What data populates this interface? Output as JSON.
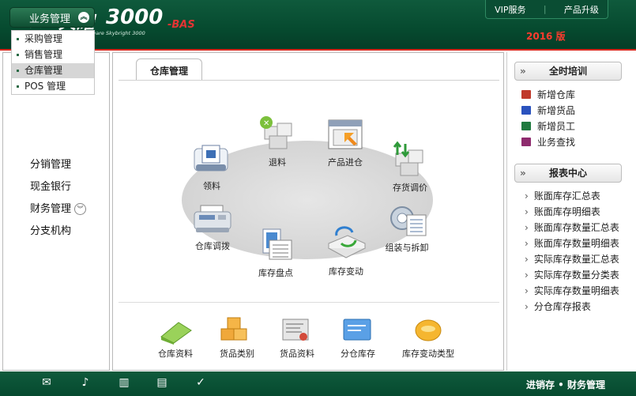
{
  "header": {
    "logo_cn": "速达",
    "logo_big": "天耀",
    "logo_num": "3000",
    "logo_bas": "-BAS",
    "logo_sub": "Superdata software Skybright 3000",
    "nav": [
      "VIP服务",
      "产品升级"
    ],
    "version": "2016 版"
  },
  "sidebar": {
    "category": "业务管理",
    "subitems": [
      "采购管理",
      "销售管理",
      "仓库管理",
      "POS 管理"
    ],
    "selected": "仓库管理",
    "menus": [
      "分销管理",
      "现金银行",
      "财务管理",
      "分支机构"
    ]
  },
  "main": {
    "tab": "仓库管理",
    "modules": [
      "领料",
      "退料",
      "产品进仓",
      "存货调价",
      "仓库调拨",
      "库存盘点",
      "库存变动",
      "组装与拆卸"
    ],
    "bottom": [
      "仓库资料",
      "货品类别",
      "货品资料",
      "分仓库存",
      "库存变动类型"
    ]
  },
  "right": {
    "training_title": "全时培训",
    "training": [
      {
        "label": "新增仓库",
        "color": "#c0392b"
      },
      {
        "label": "新增货品",
        "color": "#2a52be"
      },
      {
        "label": "新增员工",
        "color": "#1f7a3f"
      },
      {
        "label": "业务查找",
        "color": "#8e2b6e"
      }
    ],
    "report_title": "报表中心",
    "reports": [
      "账面库存汇总表",
      "账面库存明细表",
      "账面库存数量汇总表",
      "账面库存数量明细表",
      "实际库存数量汇总表",
      "实际库存数量分类表",
      "实际库存数量明细表",
      "分仓库存报表"
    ]
  },
  "footer": {
    "icons": [
      "mail-icon",
      "speaker-icon",
      "book-icon",
      "document-icon",
      "check-icon"
    ],
    "text": "进销存 • 财务管理"
  }
}
